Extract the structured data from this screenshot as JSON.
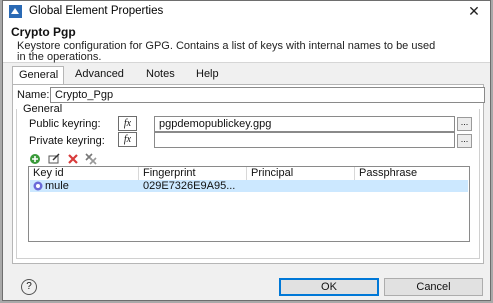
{
  "window": {
    "title": "Global Element Properties",
    "close_glyph": "✕",
    "app_icon": "app-icon"
  },
  "header": {
    "title": "Crypto Pgp",
    "description": "Keystore configuration for GPG. Contains a list of keys with internal names to be used in the operations."
  },
  "tabs": [
    {
      "label": "General",
      "active": true
    },
    {
      "label": "Advanced",
      "active": false
    },
    {
      "label": "Notes",
      "active": false
    },
    {
      "label": "Help",
      "active": false
    }
  ],
  "form": {
    "name_label": "Name:",
    "name_value": "Crypto_Pgp",
    "group_label": "General",
    "public_keyring_label": "Public keyring:",
    "public_keyring_value": "pgpdemopublickey.gpg",
    "private_keyring_label": "Private keyring:",
    "private_keyring_value": "",
    "fx_label": "fx",
    "browse_label": "..."
  },
  "toolbar": {
    "icons": [
      "add-icon",
      "edit-icon",
      "delete-icon",
      "remove-all-icon"
    ]
  },
  "table": {
    "columns": [
      "Key id",
      "Fingerprint",
      "Principal",
      "Passphrase"
    ],
    "rows": [
      {
        "key_id": "mule",
        "fingerprint": "029E7326E9A95...",
        "principal": "",
        "passphrase": ""
      }
    ]
  },
  "buttons": {
    "ok": "OK",
    "cancel": "Cancel",
    "help": "?"
  },
  "colors": {
    "selection": "#cce8ff",
    "accent": "#0078d7",
    "delete_icon": "#d83b3b",
    "add_icon": "#3a9a3a"
  }
}
